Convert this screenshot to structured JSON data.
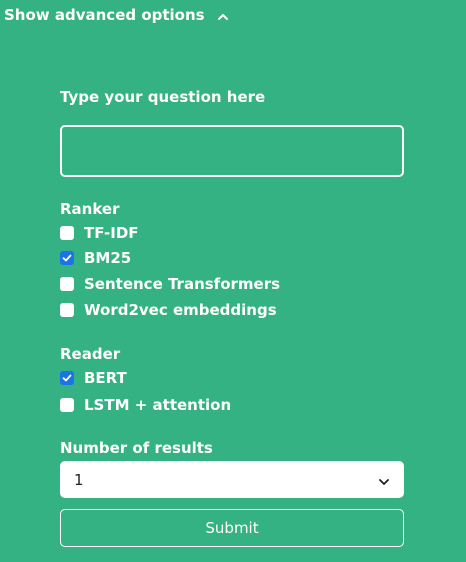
{
  "advanced": {
    "toggle_label": "Show advanced options",
    "icon": "chevron-up-icon"
  },
  "question": {
    "label": "Type your question here",
    "value": "",
    "placeholder": ""
  },
  "ranker": {
    "label": "Ranker",
    "options": [
      {
        "label": "TF-IDF",
        "checked": false
      },
      {
        "label": "BM25",
        "checked": true
      },
      {
        "label": "Sentence Transformers",
        "checked": false
      },
      {
        "label": "Word2vec embeddings",
        "checked": false
      }
    ]
  },
  "reader": {
    "label": "Reader",
    "options": [
      {
        "label": "BERT",
        "checked": true
      },
      {
        "label": "LSTM + attention",
        "checked": false
      }
    ]
  },
  "results": {
    "label": "Number of results",
    "selected": "1",
    "icon": "chevron-down-icon"
  },
  "submit": {
    "label": "Submit"
  },
  "colors": {
    "background": "#34b283",
    "checkbox_checked": "#1a73e8",
    "text": "#ffffff"
  }
}
